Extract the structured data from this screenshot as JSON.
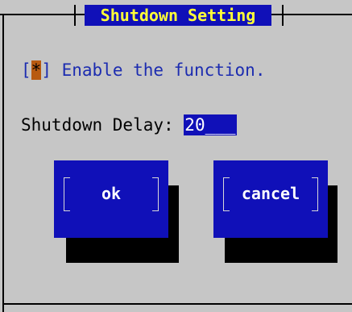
{
  "dialog": {
    "title": "Shutdown Setting"
  },
  "enable": {
    "open_bracket": "[",
    "mark": "*",
    "close_bracket": "]",
    "label": " Enable the function."
  },
  "delay": {
    "label": "Shutdown Delay: ",
    "value": "20___"
  },
  "buttons": {
    "ok_label": "ok",
    "cancel_label": "cancel"
  },
  "colors": {
    "background": "#c6c6c6",
    "dialog_blue": "#1010b8",
    "title_text": "#ffff38",
    "checkbox_mark": "#b85a10",
    "option_text": "#1c2cb0"
  }
}
